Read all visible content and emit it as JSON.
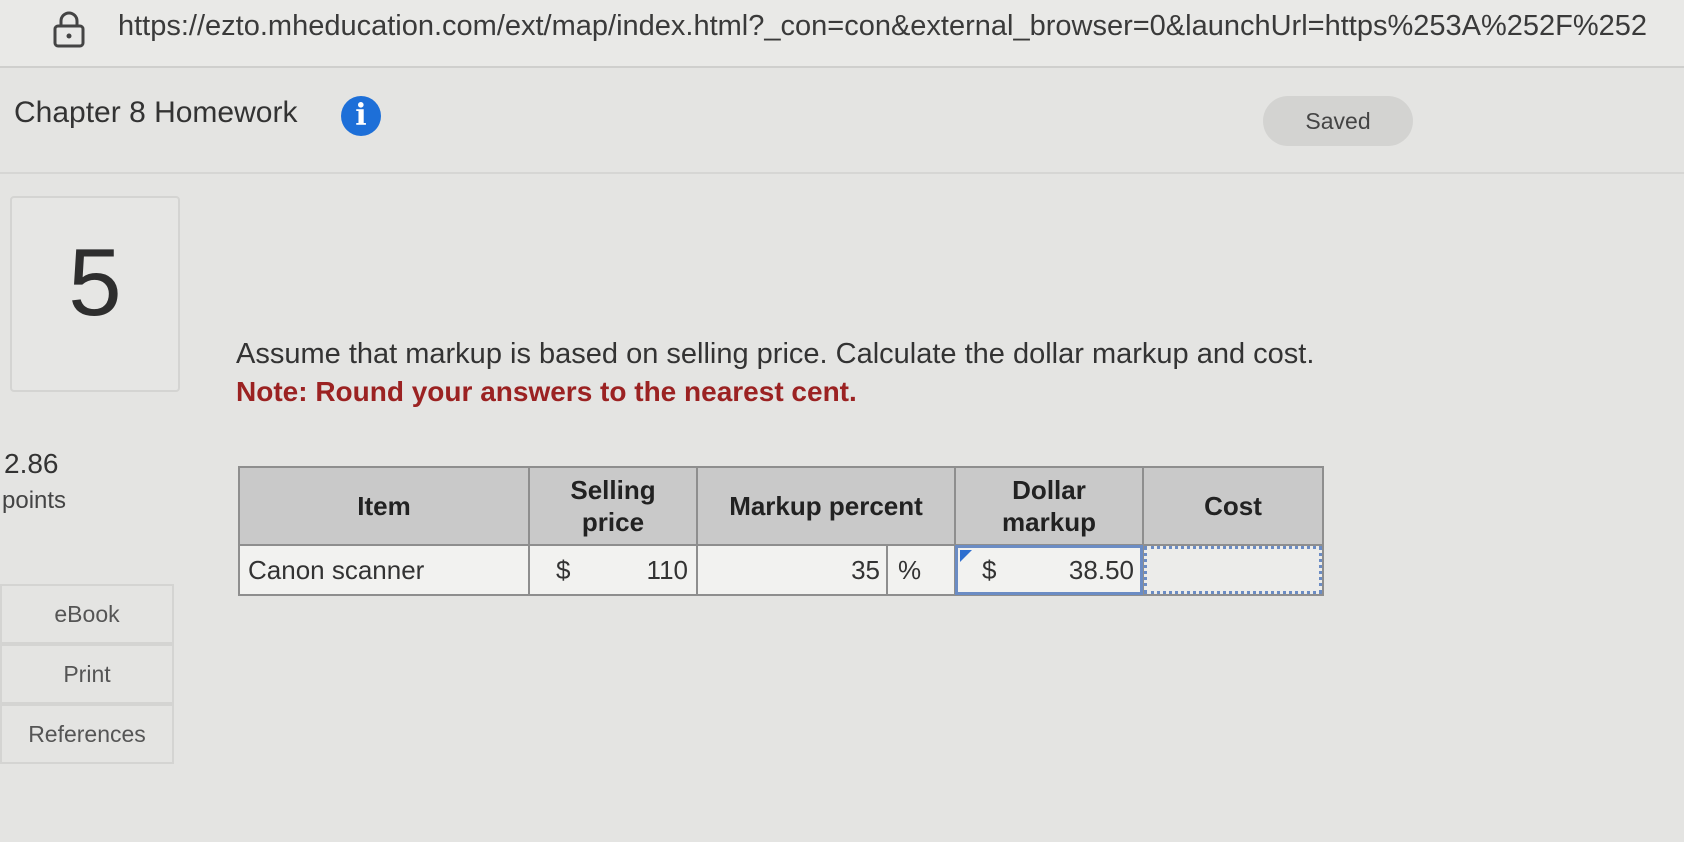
{
  "browser": {
    "url": "https://ezto.mheducation.com/ext/map/index.html?_con=con&external_browser=0&launchUrl=https%253A%252F%252"
  },
  "header": {
    "title": "Chapter 8 Homework",
    "info_icon": "info-icon",
    "status": "Saved"
  },
  "question": {
    "number": "5",
    "points_value": "2.86",
    "points_label": "points",
    "text": "Assume that markup is based on selling price. Calculate the dollar markup and cost.",
    "note": "Note: Round your answers to the nearest cent."
  },
  "sidebar": {
    "links": [
      {
        "label": "eBook"
      },
      {
        "label": "Print"
      },
      {
        "label": "References"
      }
    ]
  },
  "table": {
    "headers": [
      "Item",
      "Selling price",
      "Markup percent",
      "Dollar markup",
      "Cost"
    ],
    "rows": [
      {
        "item": "Canon scanner",
        "selling_currency": "$",
        "selling_price": "110",
        "markup_percent": "35",
        "percent_sign": "%",
        "dollar_currency": "$",
        "dollar_markup": "38.50",
        "cost": ""
      }
    ]
  },
  "colors": {
    "note": "#9b2222",
    "info_icon": "#1d6fd8",
    "header_bg": "#c9c9c9",
    "active_border": "#6b8cc4"
  }
}
